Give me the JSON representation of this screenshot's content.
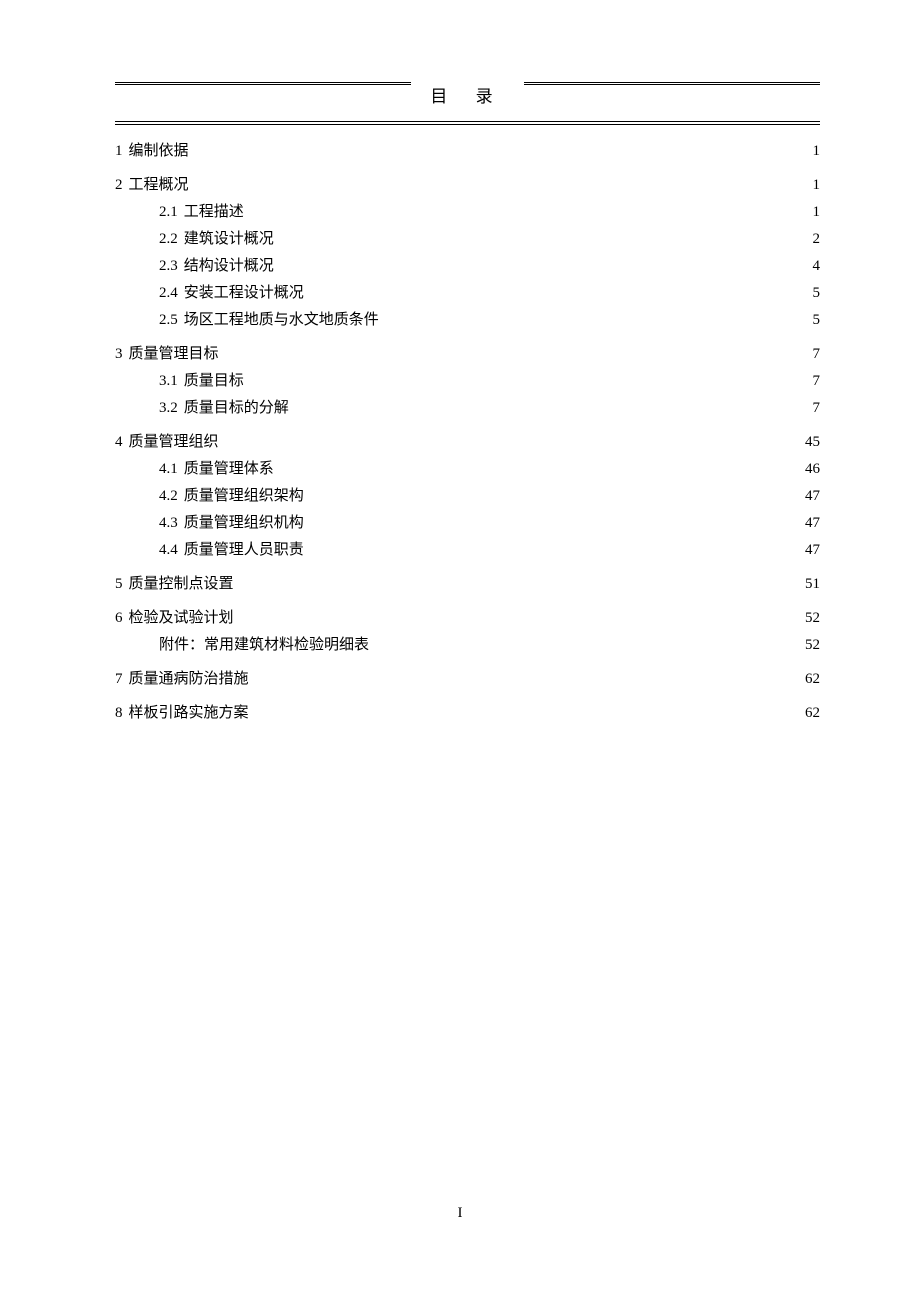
{
  "title": "目 录",
  "page_number": "I",
  "toc": [
    {
      "level": 1,
      "num": "1",
      "label": "编制依据",
      "page": "1"
    },
    {
      "level": 1,
      "num": "2",
      "label": "工程概况",
      "page": "1"
    },
    {
      "level": 2,
      "num": "2.1",
      "label": "工程描述",
      "page": "1"
    },
    {
      "level": 2,
      "num": "2.2",
      "label": "建筑设计概况",
      "page": "2"
    },
    {
      "level": 2,
      "num": "2.3",
      "label": "结构设计概况",
      "page": "4"
    },
    {
      "level": 2,
      "num": "2.4",
      "label": "安装工程设计概况",
      "page": "5"
    },
    {
      "level": 2,
      "num": "2.5",
      "label": "场区工程地质与水文地质条件",
      "page": "5"
    },
    {
      "level": 1,
      "num": "3",
      "label": "质量管理目标",
      "page": "7"
    },
    {
      "level": 2,
      "num": "3.1",
      "label": "质量目标",
      "page": "7"
    },
    {
      "level": 2,
      "num": "3.2",
      "label": "质量目标的分解",
      "page": "7"
    },
    {
      "level": 1,
      "num": "4",
      "label": "质量管理组织",
      "page": "45"
    },
    {
      "level": 2,
      "num": "4.1",
      "label": "质量管理体系",
      "page": "46"
    },
    {
      "level": 2,
      "num": "4.2",
      "label": "质量管理组织架构",
      "page": "47"
    },
    {
      "level": 2,
      "num": "4.3",
      "label": "质量管理组织机构",
      "page": "47"
    },
    {
      "level": 2,
      "num": "4.4",
      "label": "质量管理人员职责",
      "page": "47"
    },
    {
      "level": 1,
      "num": "5",
      "label": "质量控制点设置",
      "page": "51"
    },
    {
      "level": 1,
      "num": "6",
      "label": "检验及试验计划",
      "page": "52"
    },
    {
      "level": 2,
      "num": "",
      "label": "附件：常用建筑材料检验明细表",
      "page": "52",
      "attachment": true
    },
    {
      "level": 1,
      "num": "7",
      "label": "质量通病防治措施",
      "page": "62"
    },
    {
      "level": 1,
      "num": "8",
      "label": "样板引路实施方案",
      "page": "62"
    }
  ]
}
